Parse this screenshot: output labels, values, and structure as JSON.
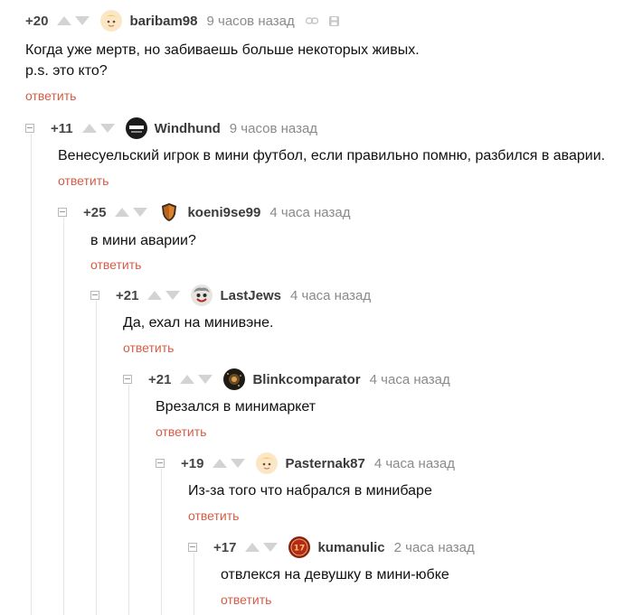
{
  "comments": [
    {
      "rating": "+20",
      "username": "baribam98",
      "time": "9 часов назад",
      "lines": [
        "Когда уже мертв, но забиваешь больше некоторых живых.",
        "p.s. это кто?"
      ],
      "reply": "ответить",
      "avatar_icon": "blond-baby-avatar-icon"
    },
    {
      "rating": "+11",
      "username": "Windhund",
      "time": "9 часов назад",
      "lines": [
        "Венесуельский игрок в мини футбол, если правильно помню, разбился в аварии."
      ],
      "reply": "ответить",
      "avatar_icon": "dark-mask-avatar-icon"
    },
    {
      "rating": "+25",
      "username": "koeni9se99",
      "time": "4 часа назад",
      "lines": [
        "в мини аварии?"
      ],
      "reply": "ответить",
      "avatar_icon": "shield-avatar-icon"
    },
    {
      "rating": "+21",
      "username": "LastJews",
      "time": "4 часа назад",
      "lines": [
        "Да, ехал на минивэне."
      ],
      "reply": "ответить",
      "avatar_icon": "clown-avatar-icon"
    },
    {
      "rating": "+21",
      "username": "Blinkcomparator",
      "time": "4 часа назад",
      "lines": [
        "Врезался в минимаркет"
      ],
      "reply": "ответить",
      "avatar_icon": "space-avatar-icon"
    },
    {
      "rating": "+19",
      "username": "Pasternak87",
      "time": "4 часа назад",
      "lines": [
        "Из-за того что набрался в минибаре"
      ],
      "reply": "ответить",
      "avatar_icon": "blond-baby-avatar-icon"
    },
    {
      "rating": "+17",
      "username": "kumanulic",
      "time": "2 часа назад",
      "lines": [
        "отвлекся на девушку в мини-юбке"
      ],
      "reply": "ответить",
      "avatar_icon": "red-badge-avatar-icon",
      "avatar_badge": "17"
    }
  ],
  "colors": {
    "reply_link": "#d35d47",
    "vote_arrow": "#d3d3d3",
    "thread_line": "#e5e5e5"
  }
}
